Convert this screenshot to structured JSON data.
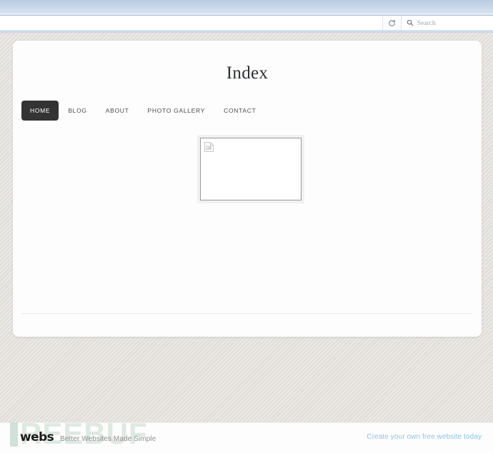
{
  "browser": {
    "url_value": "",
    "reload_icon": "reload-icon",
    "search_icon": "search-icon",
    "search_placeholder": "Search",
    "search_value": ""
  },
  "page": {
    "title": "Index",
    "nav": [
      {
        "label": "HOME",
        "active": true
      },
      {
        "label": "BLOG",
        "active": false
      },
      {
        "label": "ABOUT",
        "active": false
      },
      {
        "label": "PHOTO GALLERY",
        "active": false
      },
      {
        "label": "CONTACT",
        "active": false
      }
    ],
    "image_placeholder": {
      "icon": "broken-image-icon",
      "alt": ""
    }
  },
  "footer": {
    "watermark": "REEBUF",
    "logo": "webs",
    "tagline": "Better Websites Made Simple",
    "cta": "Create your own free website today"
  },
  "colors": {
    "nav_active_bg": "#333333",
    "cta_link": "#8cc3e8",
    "page_bg": "#e2dfda",
    "card_bg": "#fdfdfd",
    "watermark": "#d9e6dc"
  }
}
